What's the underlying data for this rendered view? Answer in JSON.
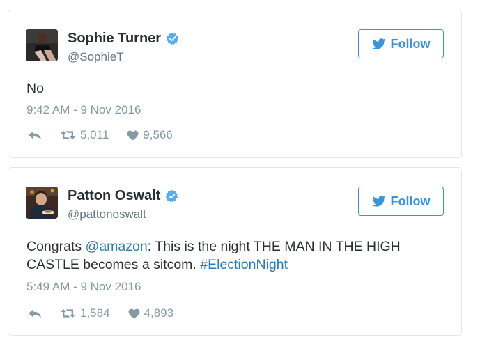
{
  "colors": {
    "link": "#2b7bb9",
    "follow_accent": "#3b94d9",
    "verified": "#55acee",
    "muted": "#8899a6",
    "text": "#292f33",
    "border": "#e1e8ed"
  },
  "tweets": [
    {
      "display_name": "Sophie Turner",
      "handle": "@SophieT",
      "verified": true,
      "follow_label": "Follow",
      "text": "No",
      "timestamp": "9:42 AM - 9 Nov 2016",
      "retweets": "5,011",
      "likes": "9,566"
    },
    {
      "display_name": "Patton Oswalt",
      "handle": "@pattonoswalt",
      "verified": true,
      "follow_label": "Follow",
      "text_parts": {
        "prefix": "Congrats ",
        "mention": "@amazon",
        "middle": ": This is the night THE MAN IN THE HIGH CASTLE becomes a sitcom. ",
        "hashtag": "#ElectionNight"
      },
      "timestamp": "5:49 AM - 9 Nov 2016",
      "retweets": "1,584",
      "likes": "4,893"
    }
  ]
}
